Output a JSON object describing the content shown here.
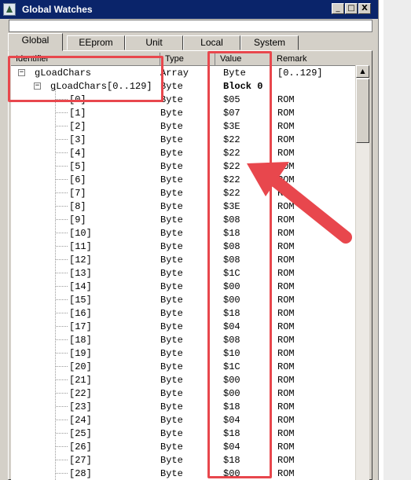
{
  "window": {
    "title": "Global Watches",
    "buttons": [
      "_",
      "□",
      "X"
    ]
  },
  "tabs": [
    {
      "label": "Global",
      "active": true
    },
    {
      "label": "EEprom",
      "active": false
    },
    {
      "label": "Unit",
      "active": false
    },
    {
      "label": "Local",
      "active": false
    },
    {
      "label": "System",
      "active": false
    }
  ],
  "columns": {
    "identifier": "Identifier",
    "type": "Type",
    "value": "Value",
    "remark": "Remark"
  },
  "rows": [
    {
      "id": "gLoadChars",
      "type": "Array",
      "value": "Byte",
      "remark": "[0..129]"
    },
    {
      "id": "gLoadChars[0..129]",
      "type": "Byte",
      "value": "Block 0",
      "remark": ""
    },
    {
      "id": "[0]",
      "type": "Byte",
      "value": "$05",
      "remark": "ROM"
    },
    {
      "id": "[1]",
      "type": "Byte",
      "value": "$07",
      "remark": "ROM"
    },
    {
      "id": "[2]",
      "type": "Byte",
      "value": "$3E",
      "remark": "ROM"
    },
    {
      "id": "[3]",
      "type": "Byte",
      "value": "$22",
      "remark": "ROM"
    },
    {
      "id": "[4]",
      "type": "Byte",
      "value": "$22",
      "remark": "ROM"
    },
    {
      "id": "[5]",
      "type": "Byte",
      "value": "$22",
      "remark": "ROM"
    },
    {
      "id": "[6]",
      "type": "Byte",
      "value": "$22",
      "remark": "ROM"
    },
    {
      "id": "[7]",
      "type": "Byte",
      "value": "$22",
      "remark": "ROM"
    },
    {
      "id": "[8]",
      "type": "Byte",
      "value": "$3E",
      "remark": "ROM"
    },
    {
      "id": "[9]",
      "type": "Byte",
      "value": "$08",
      "remark": "ROM"
    },
    {
      "id": "[10]",
      "type": "Byte",
      "value": "$18",
      "remark": "ROM"
    },
    {
      "id": "[11]",
      "type": "Byte",
      "value": "$08",
      "remark": "ROM"
    },
    {
      "id": "[12]",
      "type": "Byte",
      "value": "$08",
      "remark": "ROM"
    },
    {
      "id": "[13]",
      "type": "Byte",
      "value": "$1C",
      "remark": "ROM"
    },
    {
      "id": "[14]",
      "type": "Byte",
      "value": "$00",
      "remark": "ROM"
    },
    {
      "id": "[15]",
      "type": "Byte",
      "value": "$00",
      "remark": "ROM"
    },
    {
      "id": "[16]",
      "type": "Byte",
      "value": "$18",
      "remark": "ROM"
    },
    {
      "id": "[17]",
      "type": "Byte",
      "value": "$04",
      "remark": "ROM"
    },
    {
      "id": "[18]",
      "type": "Byte",
      "value": "$08",
      "remark": "ROM"
    },
    {
      "id": "[19]",
      "type": "Byte",
      "value": "$10",
      "remark": "ROM"
    },
    {
      "id": "[20]",
      "type": "Byte",
      "value": "$1C",
      "remark": "ROM"
    },
    {
      "id": "[21]",
      "type": "Byte",
      "value": "$00",
      "remark": "ROM"
    },
    {
      "id": "[22]",
      "type": "Byte",
      "value": "$00",
      "remark": "ROM"
    },
    {
      "id": "[23]",
      "type": "Byte",
      "value": "$18",
      "remark": "ROM"
    },
    {
      "id": "[24]",
      "type": "Byte",
      "value": "$04",
      "remark": "ROM"
    },
    {
      "id": "[25]",
      "type": "Byte",
      "value": "$18",
      "remark": "ROM"
    },
    {
      "id": "[26]",
      "type": "Byte",
      "value": "$04",
      "remark": "ROM"
    },
    {
      "id": "[27]",
      "type": "Byte",
      "value": "$18",
      "remark": "ROM"
    },
    {
      "id": "[28]",
      "type": "Byte",
      "value": "$00",
      "remark": "ROM"
    }
  ],
  "colors": {
    "titlebar": "#0a246a",
    "annotation": "#e8474d",
    "window": "#d4d0c8"
  },
  "icons": {
    "app": "triangle-app-icon",
    "expanded": "minus-box-icon",
    "scroll_up": "up-arrow-icon"
  }
}
